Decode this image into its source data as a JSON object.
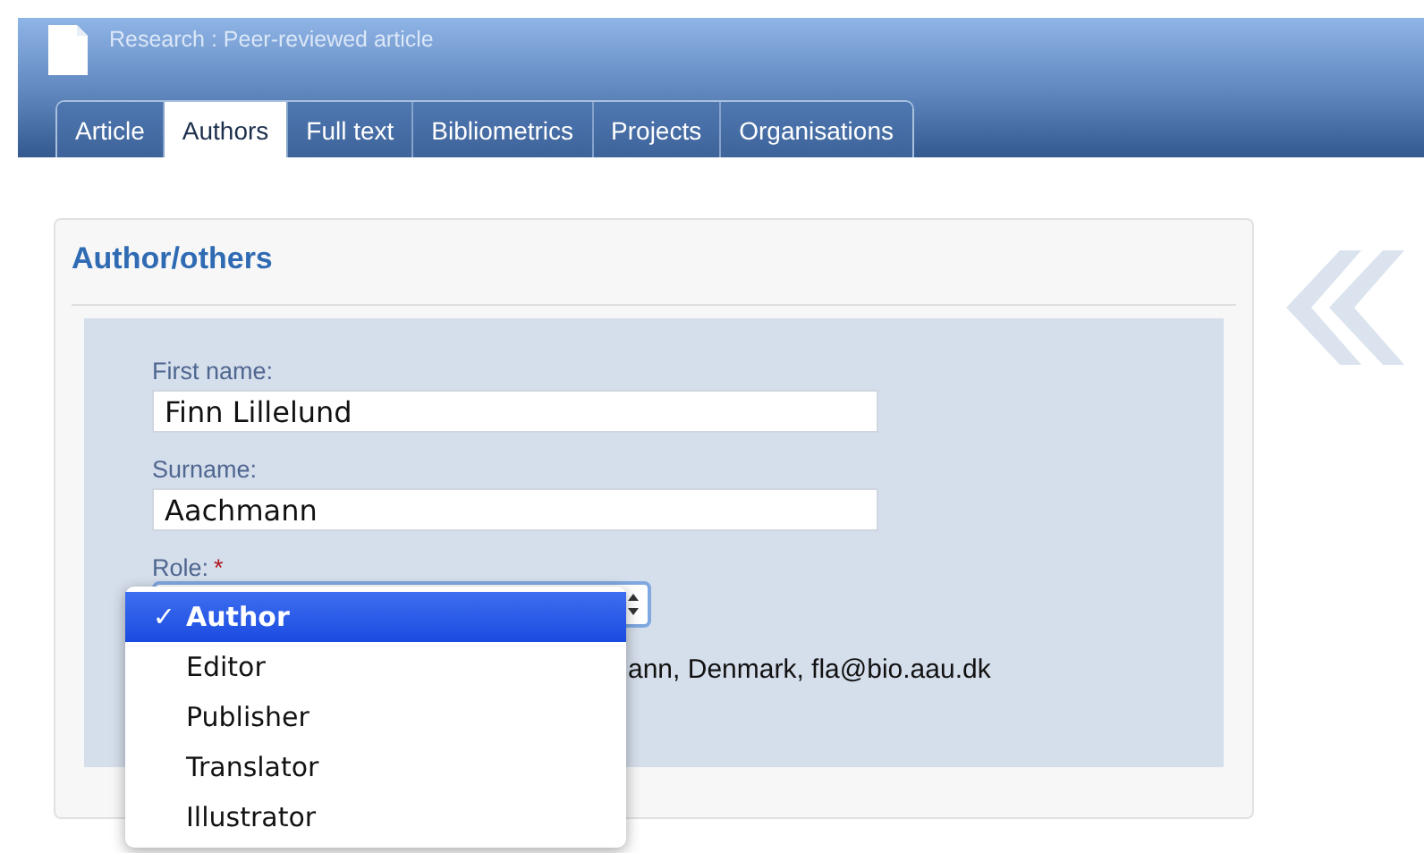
{
  "header": {
    "title": "Research : Peer-reviewed article"
  },
  "tabs": [
    {
      "label": "Article",
      "selected": false
    },
    {
      "label": "Authors",
      "selected": true
    },
    {
      "label": "Full text",
      "selected": false
    },
    {
      "label": "Bibliometrics",
      "selected": false
    },
    {
      "label": "Projects",
      "selected": false
    },
    {
      "label": "Organisations",
      "selected": false
    }
  ],
  "section": {
    "title": "Author/others"
  },
  "form": {
    "first_name": {
      "label": "First name:",
      "value": "Finn Lillelund"
    },
    "surname": {
      "label": "Surname:",
      "value": "Aachmann"
    },
    "role": {
      "label": "Role:",
      "required_mark": "*"
    },
    "affiliation_line": "ann, Denmark, fla@bio.aau.dk"
  },
  "role_menu": [
    {
      "label": "Author",
      "selected": true,
      "check": "✓"
    },
    {
      "label": "Editor",
      "selected": false
    },
    {
      "label": "Publisher",
      "selected": false
    },
    {
      "label": "Translator",
      "selected": false
    },
    {
      "label": "Illustrator",
      "selected": false
    }
  ]
}
